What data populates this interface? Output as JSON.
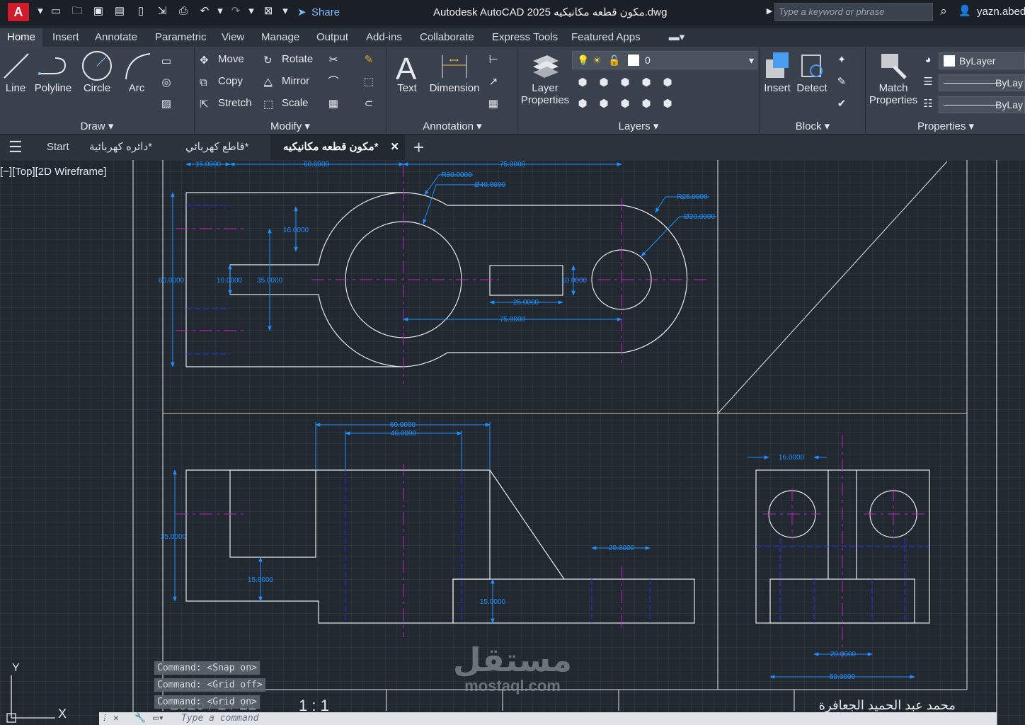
{
  "app": {
    "logo_letter": "A",
    "window_title": "Autodesk AutoCAD 2025    مكون قطعه مكانيكيه.dwg",
    "share_label": "Share",
    "search_placeholder": "Type a keyword or phrase",
    "user_name": "yazn.abed"
  },
  "menu_tabs": [
    "Home",
    "Insert",
    "Annotate",
    "Parametric",
    "View",
    "Manage",
    "Output",
    "Add-ins",
    "Collaborate",
    "Express Tools",
    "Featured Apps"
  ],
  "ribbon": {
    "draw": {
      "label": "Draw",
      "line": "Line",
      "polyline": "Polyline",
      "circle": "Circle",
      "arc": "Arc"
    },
    "modify": {
      "label": "Modify",
      "move": "Move",
      "rotate": "Rotate",
      "copy": "Copy",
      "mirror": "Mirror",
      "stretch": "Stretch",
      "scale": "Scale"
    },
    "annotation": {
      "label": "Annotation",
      "text": "Text",
      "dimension": "Dimension"
    },
    "layers": {
      "label": "Layers",
      "layer_properties_1": "Layer",
      "layer_properties_2": "Properties",
      "current_layer": "0"
    },
    "block": {
      "label": "Block",
      "insert": "Insert",
      "detect": "Detect"
    },
    "properties": {
      "label": "Properties",
      "match_1": "Match",
      "match_2": "Properties",
      "color": "ByLayer",
      "linetype": "ByLay",
      "lineweight": "ByLay"
    }
  },
  "doc_tabs": {
    "start": "Start",
    "tab1": "دائره كهربائية*",
    "tab2": "قاطع كهربائي*",
    "active": "مكون قطعه مكانيكيه*"
  },
  "viewport": {
    "label": "[−][Top][2D Wireframe]",
    "ucs_y": "Y",
    "ucs_x": "X"
  },
  "drawing": {
    "top_view_dims": {
      "d15": "15.0000",
      "d60": "60.0000",
      "d75": "75.0000",
      "r30": "R30.0000",
      "dia40": "Ø40.0000",
      "r25": "R25.0000",
      "dia20": "Ø20.0000",
      "d16": "16.0000",
      "d60v": "60.0000",
      "d10": "10.0000",
      "d35": "35.0000",
      "d10b": "10.0000",
      "d25": "25.0000",
      "d75b": "75.0000"
    },
    "front_view_dims": {
      "d60": "60.0000",
      "d40": "40.0000",
      "d35": "35.0000",
      "d15a": "15.0000",
      "d15b": "15.0000",
      "d20": "20.0000"
    },
    "side_view_dims": {
      "d16": "16.0000",
      "d20": "20.0000",
      "d50": "50.0000"
    },
    "title_block": {
      "date": "2025 / 2 / 21",
      "scale": "1 : 1",
      "author": "محمد عبد الحميد الجعافرة"
    }
  },
  "command_history": [
    "Command:  <Snap on>",
    "Command:  <Grid off>",
    "Command:  <Grid on>"
  ],
  "command_prompt": "Type a command",
  "watermark": {
    "arabic": "مستقل",
    "latin": "mostaql.com"
  },
  "colors": {
    "background": "#212830",
    "dimension": "#1e90ff",
    "centerline": "#c51fc5",
    "geometry": "#e8e8e8",
    "hidden": "#2a2aff"
  }
}
